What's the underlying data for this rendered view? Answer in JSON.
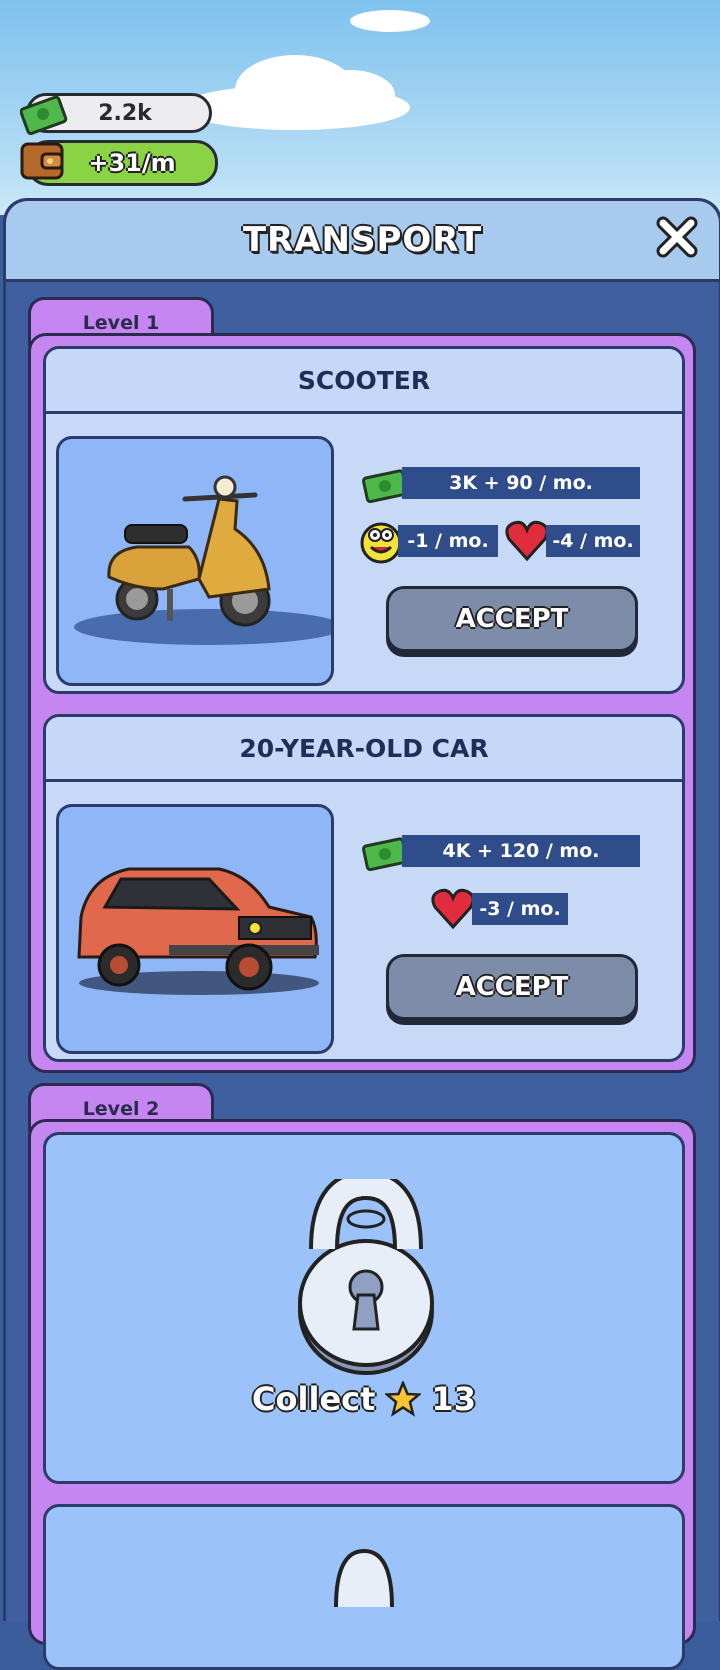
{
  "hud": {
    "money": "2.2k",
    "income": "+31/m"
  },
  "panel": {
    "title": "TRANSPORT"
  },
  "levels": [
    {
      "label": "Level 1",
      "cards": [
        {
          "name": "SCOOTER",
          "cost": "3K + 90 / mo.",
          "mood": "-1 / mo.",
          "health": "-4 / mo.",
          "accept": "ACCEPT"
        },
        {
          "name": "20-YEAR-OLD CAR",
          "cost": "4K + 120 / mo.",
          "health": "-3 / mo.",
          "accept": "ACCEPT"
        }
      ]
    },
    {
      "label": "Level 2",
      "locked": {
        "collect_label": "Collect",
        "stars": "13"
      }
    }
  ],
  "colors": {
    "accent": "#c586f2",
    "button": "#7d8ca8",
    "panel": "#3f5f9f"
  }
}
